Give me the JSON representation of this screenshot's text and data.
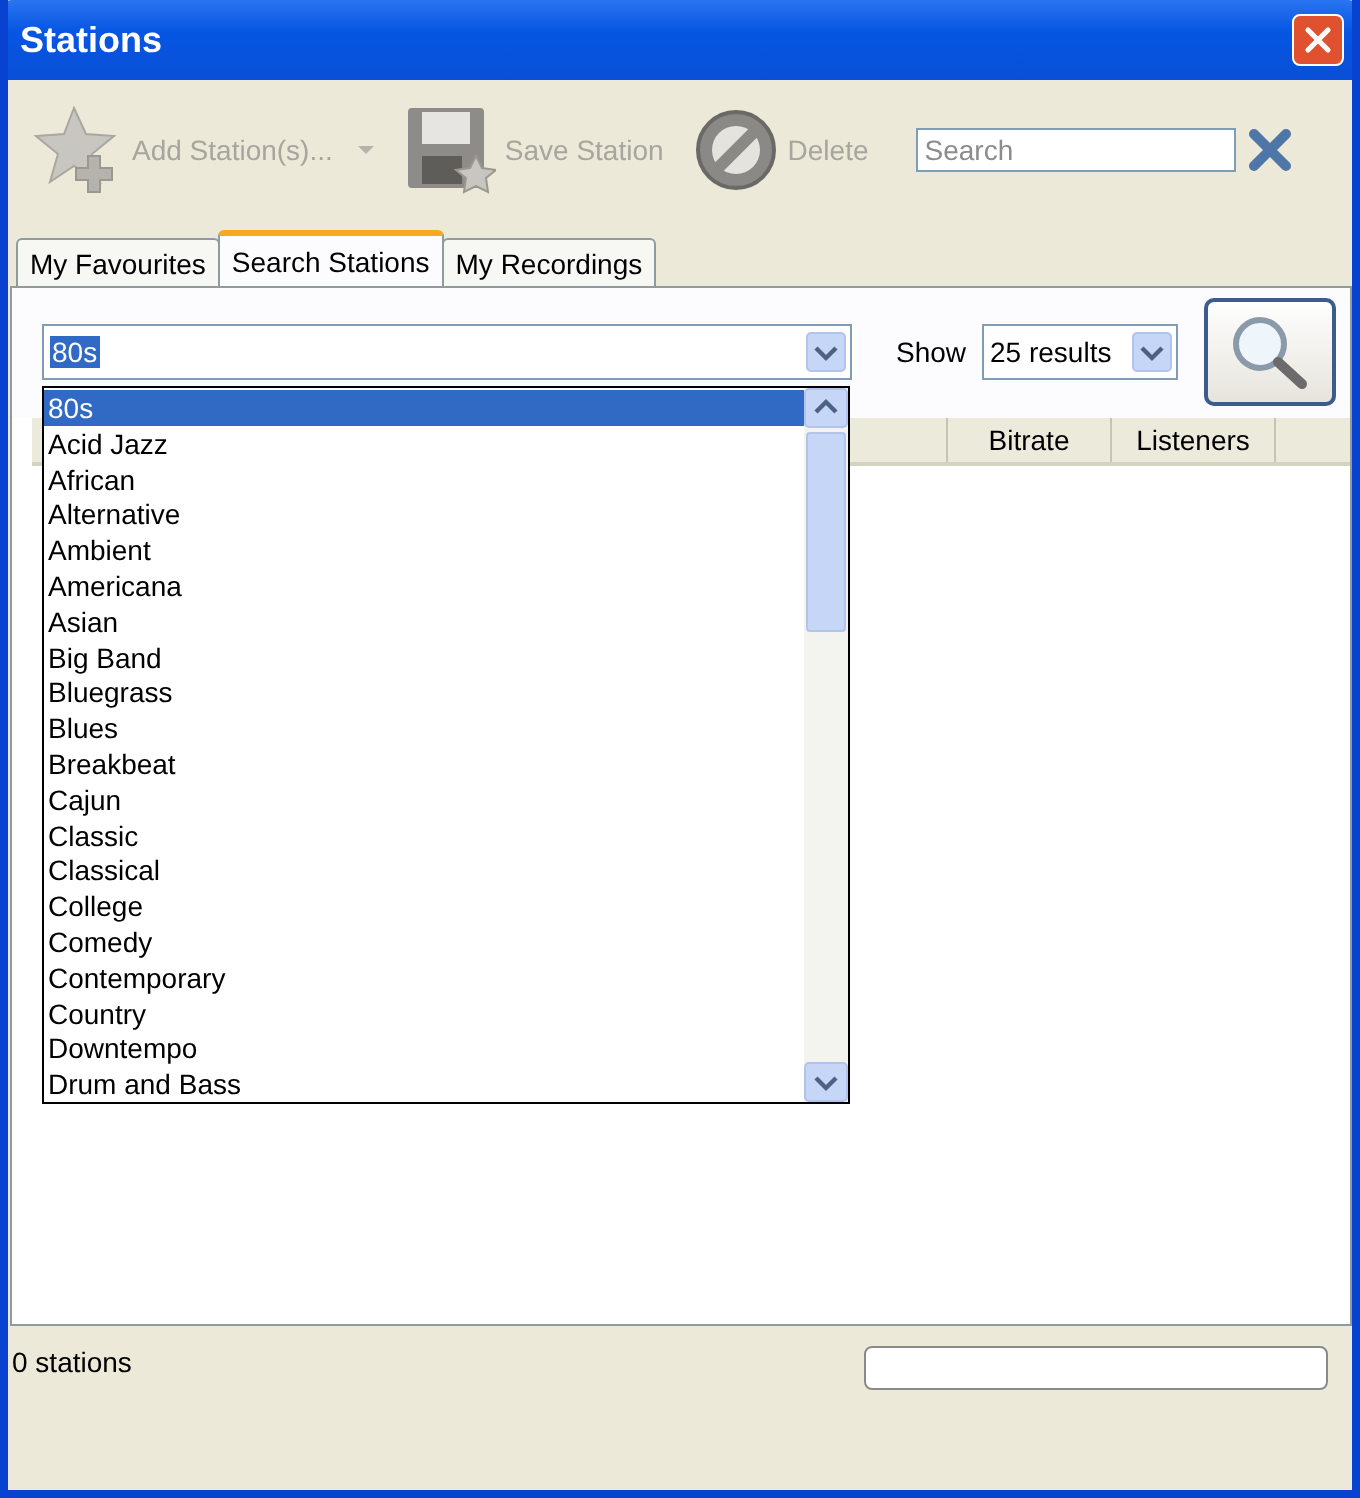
{
  "window": {
    "title": "Stations"
  },
  "toolbar": {
    "buttons": [
      {
        "kind": "add",
        "label": "Add Station(s)...",
        "disabled": true
      },
      {
        "kind": "save",
        "label": "Save Station",
        "disabled": true
      },
      {
        "kind": "delete",
        "label": "Delete",
        "disabled": true
      }
    ],
    "search": {
      "placeholder": "Search"
    }
  },
  "tabs": [
    {
      "label": "My Favourites",
      "selected": false
    },
    {
      "label": "Search Stations",
      "selected": true
    },
    {
      "label": "My Recordings",
      "selected": false
    }
  ],
  "genre": {
    "value": "80s"
  },
  "show": {
    "label": "Show",
    "value": "25 results"
  },
  "table": {
    "columns": [
      "Bitrate",
      "Listeners"
    ]
  },
  "genre_list": [
    {
      "label": "80s",
      "selected": true
    },
    {
      "label": "Acid Jazz",
      "selected": false
    },
    {
      "label": "African",
      "selected": false
    },
    {
      "label": "Alternative",
      "selected": false
    },
    {
      "label": "Ambient",
      "selected": false
    },
    {
      "label": "Americana",
      "selected": false
    },
    {
      "label": "Asian",
      "selected": false
    },
    {
      "label": "Big Band",
      "selected": false
    },
    {
      "label": "Bluegrass",
      "selected": false
    },
    {
      "label": "Blues",
      "selected": false
    },
    {
      "label": "Breakbeat",
      "selected": false
    },
    {
      "label": "Cajun",
      "selected": false
    },
    {
      "label": "Classic",
      "selected": false
    },
    {
      "label": "Classical",
      "selected": false
    },
    {
      "label": "College",
      "selected": false
    },
    {
      "label": "Comedy",
      "selected": false
    },
    {
      "label": "Contemporary",
      "selected": false
    },
    {
      "label": "Country",
      "selected": false
    },
    {
      "label": "Downtempo",
      "selected": false
    },
    {
      "label": "Drum and Bass",
      "selected": false
    }
  ],
  "status_bar": {
    "text": "0 stations",
    "progress": {
      "level": 0
    }
  }
}
